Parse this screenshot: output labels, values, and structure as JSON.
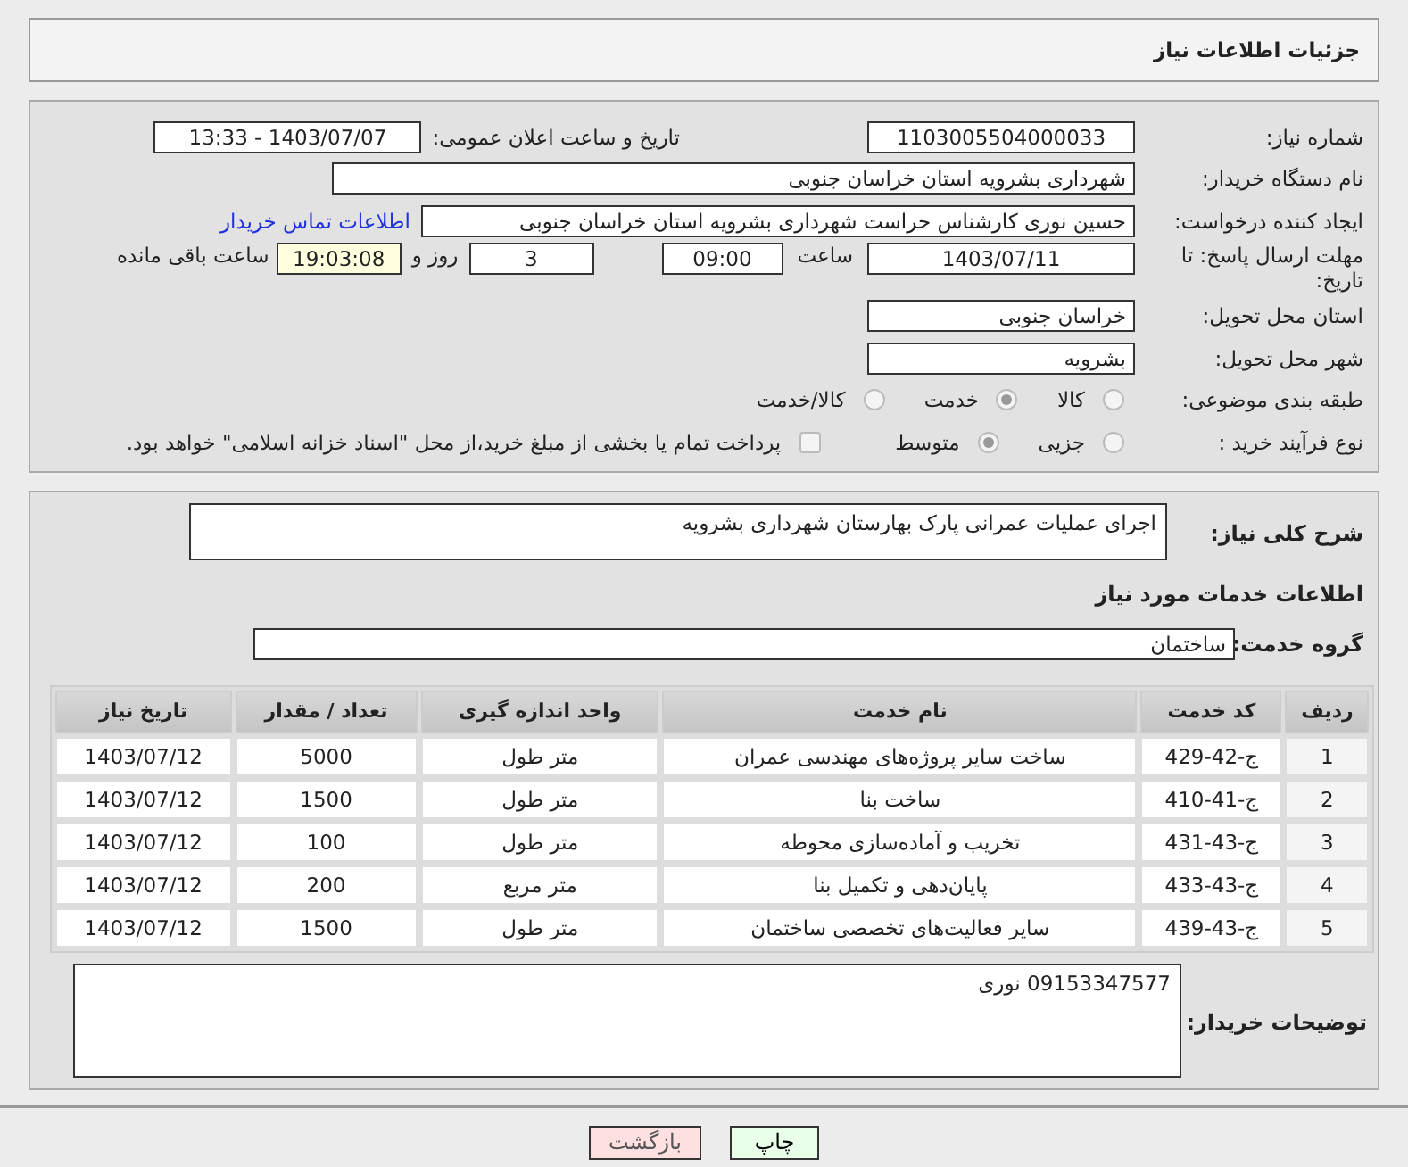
{
  "header_title": "جزئیات اطلاعات نیاز",
  "need_number": {
    "label": "شماره نیاز:",
    "value": "1103005504000033"
  },
  "announce": {
    "label": "تاریخ و ساعت اعلان عمومی:",
    "value": "1403/07/07 - 13:33"
  },
  "buyer_org": {
    "label": "نام دستگاه خریدار:",
    "value": "شهرداری بشرویه استان خراسان جنوبی"
  },
  "requester": {
    "label": "ایجاد کننده درخواست:",
    "value": "حسین نوری کارشناس حراست شهرداری بشرویه استان خراسان جنوبی",
    "link": "اطلاعات تماس خریدار"
  },
  "deadline": {
    "label": "مهلت ارسال پاسخ: تا تاریخ:",
    "date": "1403/07/11",
    "time_label": "ساعت",
    "time": "09:00",
    "days": "3",
    "days_label": "روز و",
    "remaining": "19:03:08",
    "remaining_label": "ساعت باقی مانده"
  },
  "province": {
    "label": "استان محل تحویل:",
    "value": "خراسان جنوبی"
  },
  "city": {
    "label": "شهر محل تحویل:",
    "value": "بشرویه"
  },
  "category": {
    "label": "طبقه بندی موضوعی:",
    "options": [
      {
        "label": "کالا",
        "selected": false
      },
      {
        "label": "خدمت",
        "selected": true
      },
      {
        "label": "کالا/خدمت",
        "selected": false
      }
    ]
  },
  "process": {
    "label": "نوع فرآیند خرید :",
    "options": [
      {
        "label": "جزیی",
        "selected": false
      },
      {
        "label": "متوسط",
        "selected": true
      }
    ],
    "payment": {
      "label": "پرداخت تمام یا بخشی از مبلغ خرید،از محل \"اسناد خزانه اسلامی\" خواهد بود.",
      "checked": false
    }
  },
  "description": {
    "label": "شرح کلی نیاز:",
    "value": "اجرای عملیات عمرانی پارک بهارستان شهرداری بشرویه"
  },
  "services_title": "اطلاعات خدمات مورد نیاز",
  "service_group": {
    "label": "گروه خدمت:",
    "value": "ساختمان"
  },
  "table": {
    "columns": [
      "ردیف",
      "کد خدمت",
      "نام خدمت",
      "واحد اندازه گیری",
      "تعداد / مقدار",
      "تاریخ نیاز"
    ],
    "rows": [
      [
        "1",
        "ج-42-429",
        "ساخت سایر پروژه‌های مهندسی عمران",
        "متر طول",
        "5000",
        "1403/07/12"
      ],
      [
        "2",
        "ج-41-410",
        "ساخت بنا",
        "متر طول",
        "1500",
        "1403/07/12"
      ],
      [
        "3",
        "ج-43-431",
        "تخریب و آماده‌سازی محوطه",
        "متر طول",
        "100",
        "1403/07/12"
      ],
      [
        "4",
        "ج-43-433",
        "پایان‌دهی و تکمیل بنا",
        "متر مربع",
        "200",
        "1403/07/12"
      ],
      [
        "5",
        "ج-43-439",
        "سایر فعالیت‌های تخصصی ساختمان",
        "متر طول",
        "1500",
        "1403/07/12"
      ]
    ]
  },
  "buyer_notes": {
    "label": "توضیحات خریدار:",
    "value": "09153347577 نوری"
  },
  "buttons": [
    {
      "label": "چاپ",
      "kind": "print"
    },
    {
      "label": "بازگشت",
      "kind": "back"
    }
  ]
}
